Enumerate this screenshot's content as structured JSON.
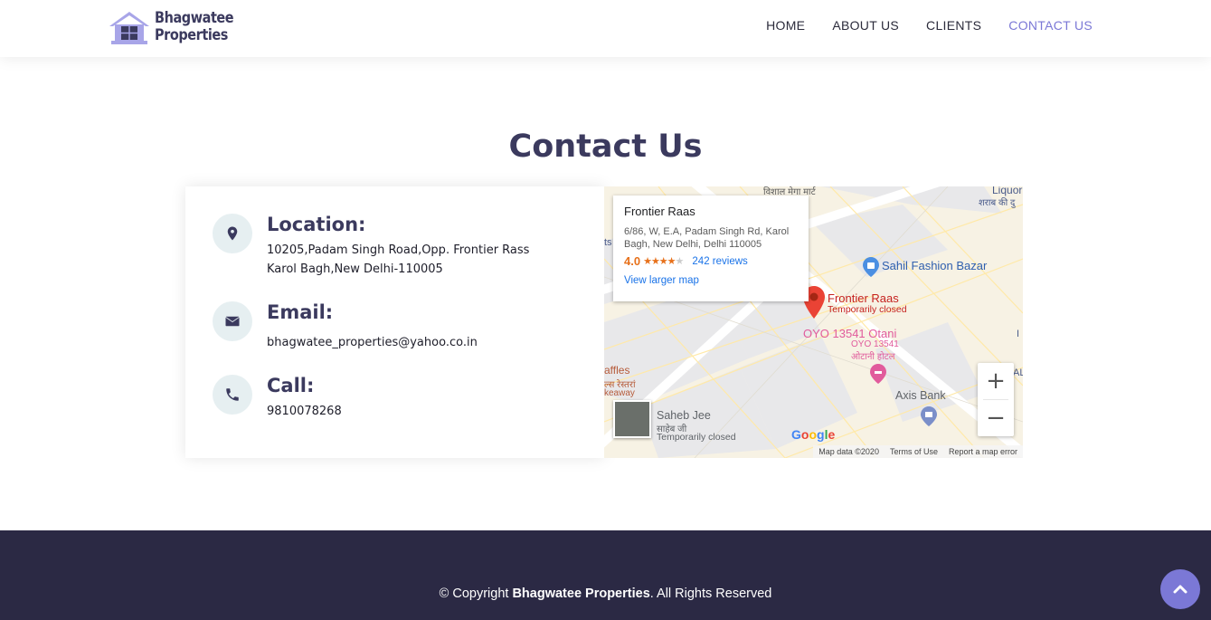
{
  "brand": {
    "line1": "Bhagwatee",
    "line2": "Properties"
  },
  "nav": {
    "items": [
      {
        "label": "HOME",
        "active": false
      },
      {
        "label": "ABOUT US",
        "active": false
      },
      {
        "label": "CLIENTS",
        "active": false
      },
      {
        "label": "CONTACT US",
        "active": true
      }
    ],
    "active_color": "#7b78d6"
  },
  "page_title": "Contact Us",
  "contact": {
    "location": {
      "title": "Location:",
      "line1": "10205,Padam Singh Road,Opp. Frontier Rass",
      "line2": "Karol Bagh,New Delhi-110005",
      "icon": "map-marker-icon"
    },
    "email": {
      "title": "Email:",
      "value": "bhagwatee_properties@yahoo.co.in",
      "icon": "envelope-icon"
    },
    "call": {
      "title": "Call:",
      "value": "9810078268",
      "icon": "phone-icon"
    }
  },
  "map": {
    "place_name": "Frontier Raas",
    "address_line1": "6/86, W, E.A, Padam Singh Rd, Karol",
    "address_line2": "Bagh, New Delhi, Delhi 110005",
    "rating": "4.0",
    "stars": "★★★★★",
    "reviews": "242 reviews",
    "larger_map": "View larger map",
    "labels": {
      "top_hindi": "विशाल मेगा मार्ट",
      "liquor_1": "Liquor Sho",
      "liquor_2": "शराब की दु",
      "sahil": "Sahil Fashion Bazar",
      "frontier_name": "Frontier Raas",
      "frontier_status": "Temporarily closed",
      "oyo_1": "OYO 13541 Otani",
      "oyo_2": "OYO 13541",
      "oyo_3": "ओटानी होटल",
      "raffles_1": "affles",
      "raffles_2": "ल्स रेस्तरां",
      "raffles_3": "keaway",
      "axis": "Axis Bank",
      "saheb_1": "Saheb Jee",
      "saheb_2": "साहेब जी",
      "saheb_3": "Temporarily closed",
      "left_edge": "ts",
      "right_i": "I",
      "right_al": "AL"
    },
    "google": "Google",
    "footer": {
      "data": "Map data ©2020",
      "terms": "Terms of Use",
      "report": "Report a map error"
    },
    "zoom_in": "+",
    "zoom_out": "−"
  },
  "footer": {
    "prefix": "© Copyright ",
    "brand": "Bhagwatee Properties",
    "suffix": ". All Rights Reserved"
  }
}
